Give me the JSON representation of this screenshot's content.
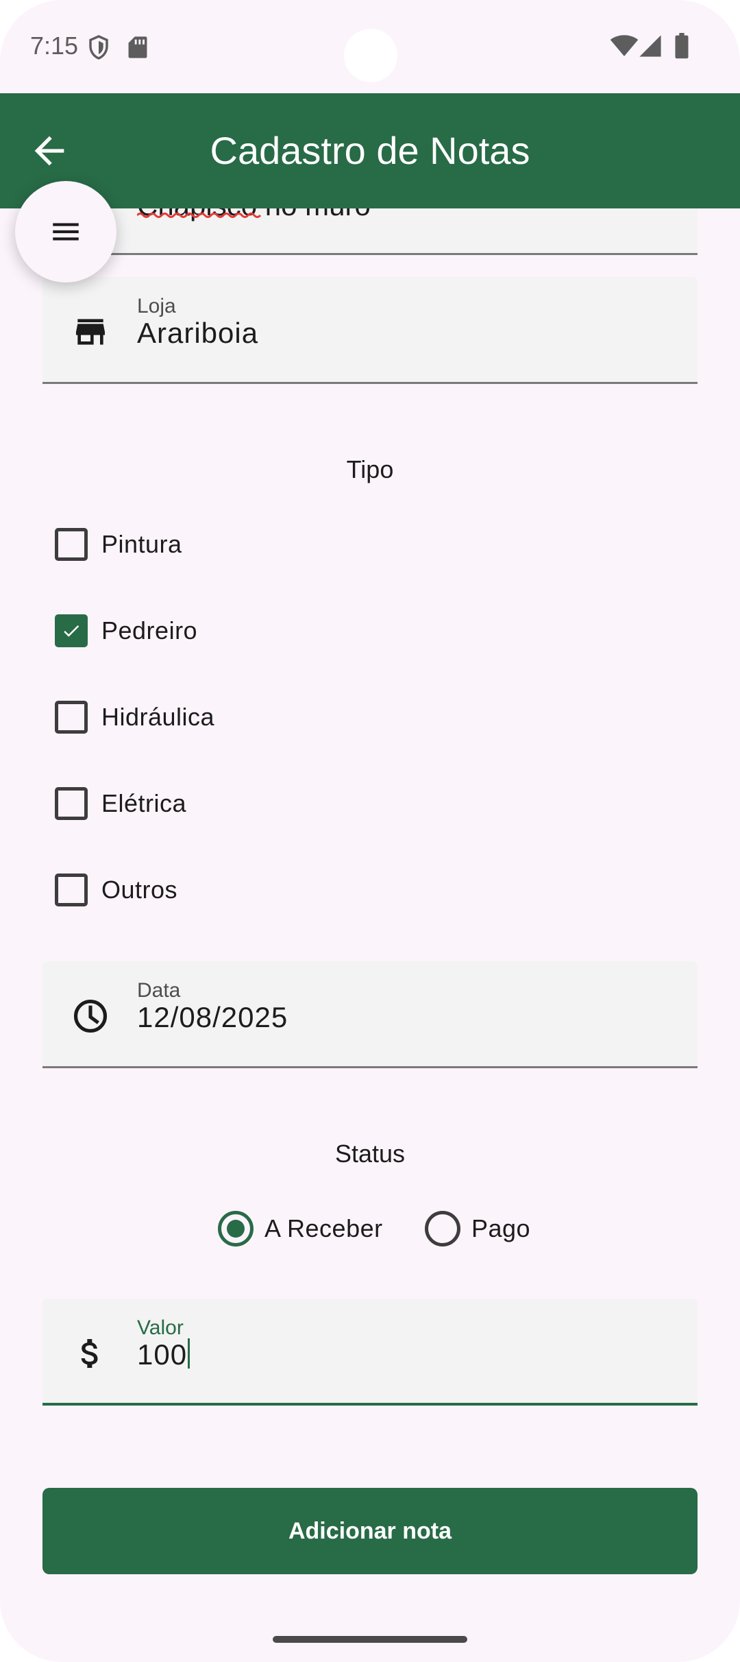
{
  "status_bar": {
    "time": "7:15",
    "icons": [
      "shield-icon",
      "sd-card-icon",
      "wifi-icon",
      "signal-icon",
      "battery-icon"
    ]
  },
  "app_bar": {
    "title": "Cadastro de Notas",
    "back_icon": "arrow-back-icon",
    "color": "#286b47"
  },
  "menu_fab": {
    "icon": "menu-icon"
  },
  "form": {
    "partial_field_text": "Chapisco no muro",
    "loja": {
      "label": "Loja",
      "value": "Arariboia",
      "icon": "store-icon"
    },
    "tipo": {
      "title": "Tipo",
      "options": [
        {
          "label": "Pintura",
          "checked": false
        },
        {
          "label": "Pedreiro",
          "checked": true
        },
        {
          "label": "Hidráulica",
          "checked": false
        },
        {
          "label": "Elétrica",
          "checked": false
        },
        {
          "label": "Outros",
          "checked": false
        }
      ]
    },
    "data": {
      "label": "Data",
      "value": "12/08/2025",
      "icon": "clock-icon"
    },
    "status": {
      "title": "Status",
      "options": [
        {
          "label": "A Receber",
          "selected": true
        },
        {
          "label": "Pago",
          "selected": false
        }
      ]
    },
    "valor": {
      "label": "Valor",
      "value": "100",
      "icon": "dollar-icon"
    },
    "submit_label": "Adicionar nota"
  },
  "colors": {
    "accent": "#286b47",
    "background": "#fcf4fb",
    "field": "#f3f3f3"
  }
}
